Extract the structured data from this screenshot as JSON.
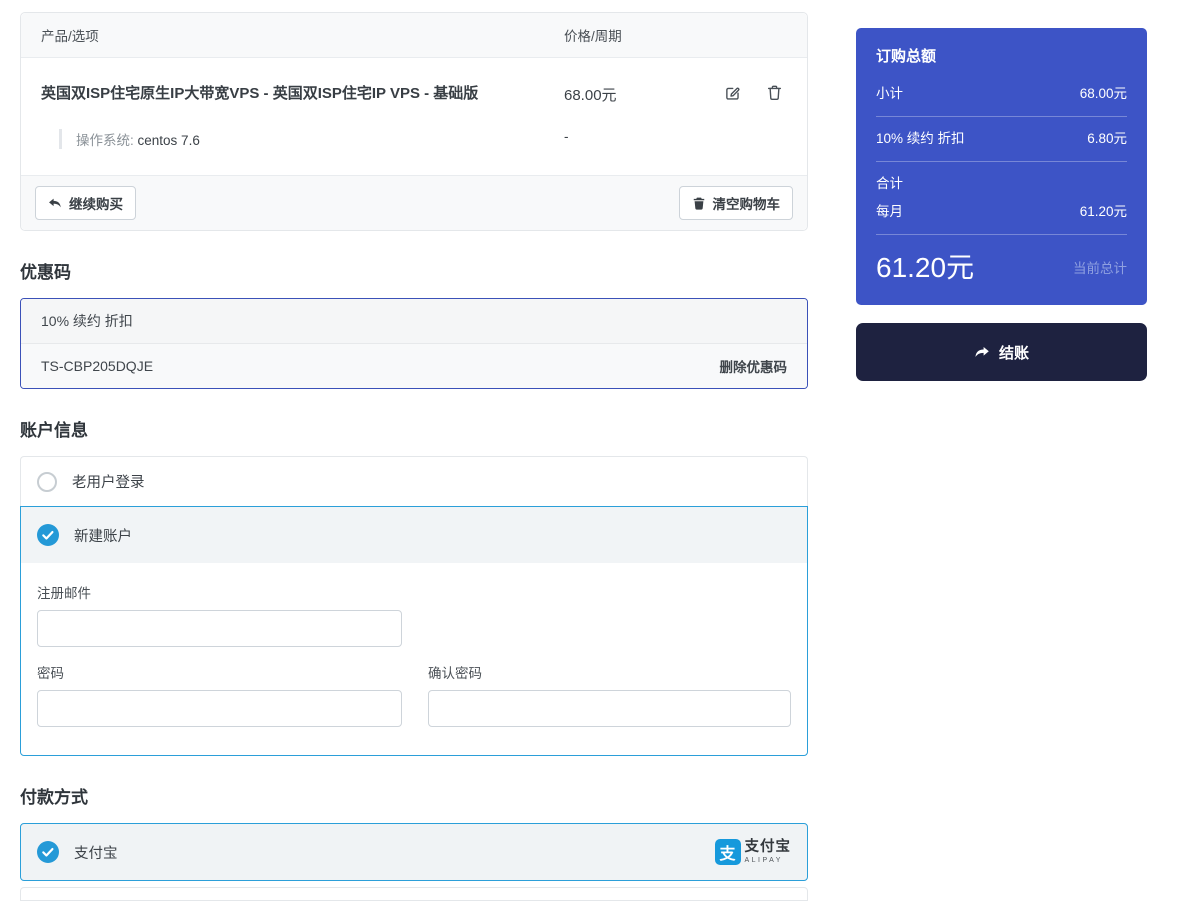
{
  "colors": {
    "primary_blue": "#3d54c6",
    "checkout_navy": "#1e2240",
    "selected_blue": "#2499d7",
    "coupon_border_blue": "#3b51b8",
    "alipay_blue": "#1699dc",
    "panel_gray": "#f8f9fa"
  },
  "cart": {
    "columns": {
      "product": "产品/选项",
      "price": "价格/周期"
    },
    "item": {
      "title": "英国双ISP住宅原生IP大带宽VPS - 英国双ISP住宅IP VPS - 基础版",
      "price": "68.00元",
      "option_label": "操作系统:",
      "option_value": "centos 7.6",
      "option_price": "-"
    },
    "continue_button": "继续购买",
    "empty_button": "清空购物车"
  },
  "coupon": {
    "heading": "优惠码",
    "description": "10% 续约 折扣",
    "code": "TS-CBP205DQJE",
    "remove_link": "删除优惠码"
  },
  "account": {
    "heading": "账户信息",
    "existing_user_label": "老用户登录",
    "new_account_label": "新建账户",
    "form": {
      "email_label": "注册邮件",
      "password_label": "密码",
      "confirm_label": "确认密码",
      "email_value": "",
      "password_value": "",
      "confirm_value": ""
    }
  },
  "payment": {
    "heading": "付款方式",
    "method_label": "支付宝",
    "alipay_glyph": "支",
    "alipay_name": "支付宝",
    "alipay_sub": "ALIPAY"
  },
  "summary": {
    "title": "订购总额",
    "subtotal_label": "小计",
    "subtotal_value": "68.00元",
    "discount_label": "10% 续约 折扣",
    "discount_value": "6.80元",
    "total_label": "合计",
    "cycle_label": "每月",
    "cycle_value": "61.20元",
    "grand_total": "61.20元",
    "grand_total_caption": "当前总计",
    "checkout_label": "结账"
  },
  "icons": {
    "continue": "reply-arrow-icon",
    "empty_cart": "trash-icon",
    "edit_item": "edit-icon",
    "delete_item": "trash-icon",
    "selected_option": "check-circle-icon",
    "unselected_option": "radio-circle-icon",
    "checkout": "forward-arrow-icon",
    "alipay": "alipay-mark-icon"
  }
}
